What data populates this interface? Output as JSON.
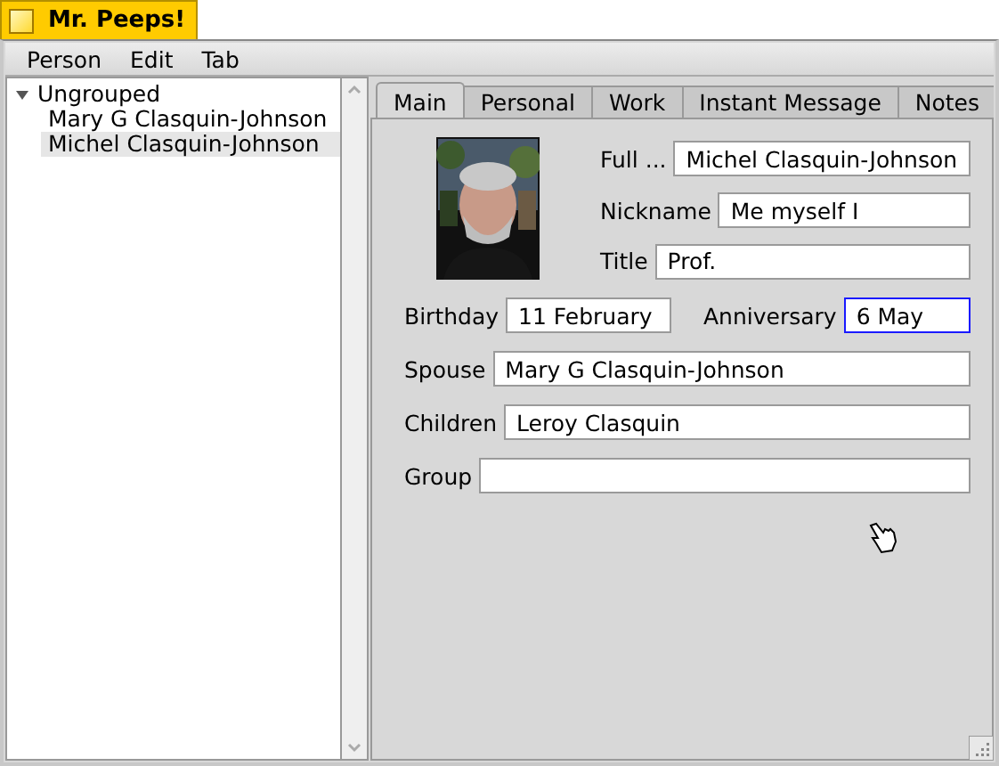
{
  "window": {
    "title": "Mr. Peeps!"
  },
  "menu": [
    "Person",
    "Edit",
    "Tab"
  ],
  "tree": [
    {
      "label": "Ungrouped",
      "expanded": true,
      "selected": false,
      "children": [
        {
          "label": "Mary G Clasquin-Johnson",
          "selected": false
        },
        {
          "label": "Michel Clasquin-Johnson",
          "selected": true
        }
      ]
    }
  ],
  "tabs": [
    {
      "label": "Main",
      "selected": true
    },
    {
      "label": "Personal",
      "selected": false
    },
    {
      "label": "Work",
      "selected": false
    },
    {
      "label": "Instant Message",
      "selected": false
    },
    {
      "label": "Notes",
      "selected": false
    }
  ],
  "photo": {
    "kind": "picture"
  },
  "header_fields": [
    {
      "label": "Full ...",
      "value": "Michel Clasquin-Johnson",
      "focused": false
    },
    {
      "label": "Nickname",
      "value": "Me myself I",
      "focused": false
    },
    {
      "label": "Title",
      "value": "Prof.",
      "focused": false
    }
  ],
  "rows": [
    [
      {
        "label": "Birthday",
        "value": "11 February",
        "focused": false
      },
      {
        "label": "Anniversary",
        "value": "6 May",
        "focused": true
      }
    ],
    [
      {
        "label": "Spouse",
        "value": "Mary G Clasquin-Johnson",
        "focused": false
      }
    ],
    [
      {
        "label": "Children",
        "value": "Leroy Clasquin",
        "focused": false
      }
    ],
    [
      {
        "label": "Group",
        "focused": false
      }
    ]
  ]
}
